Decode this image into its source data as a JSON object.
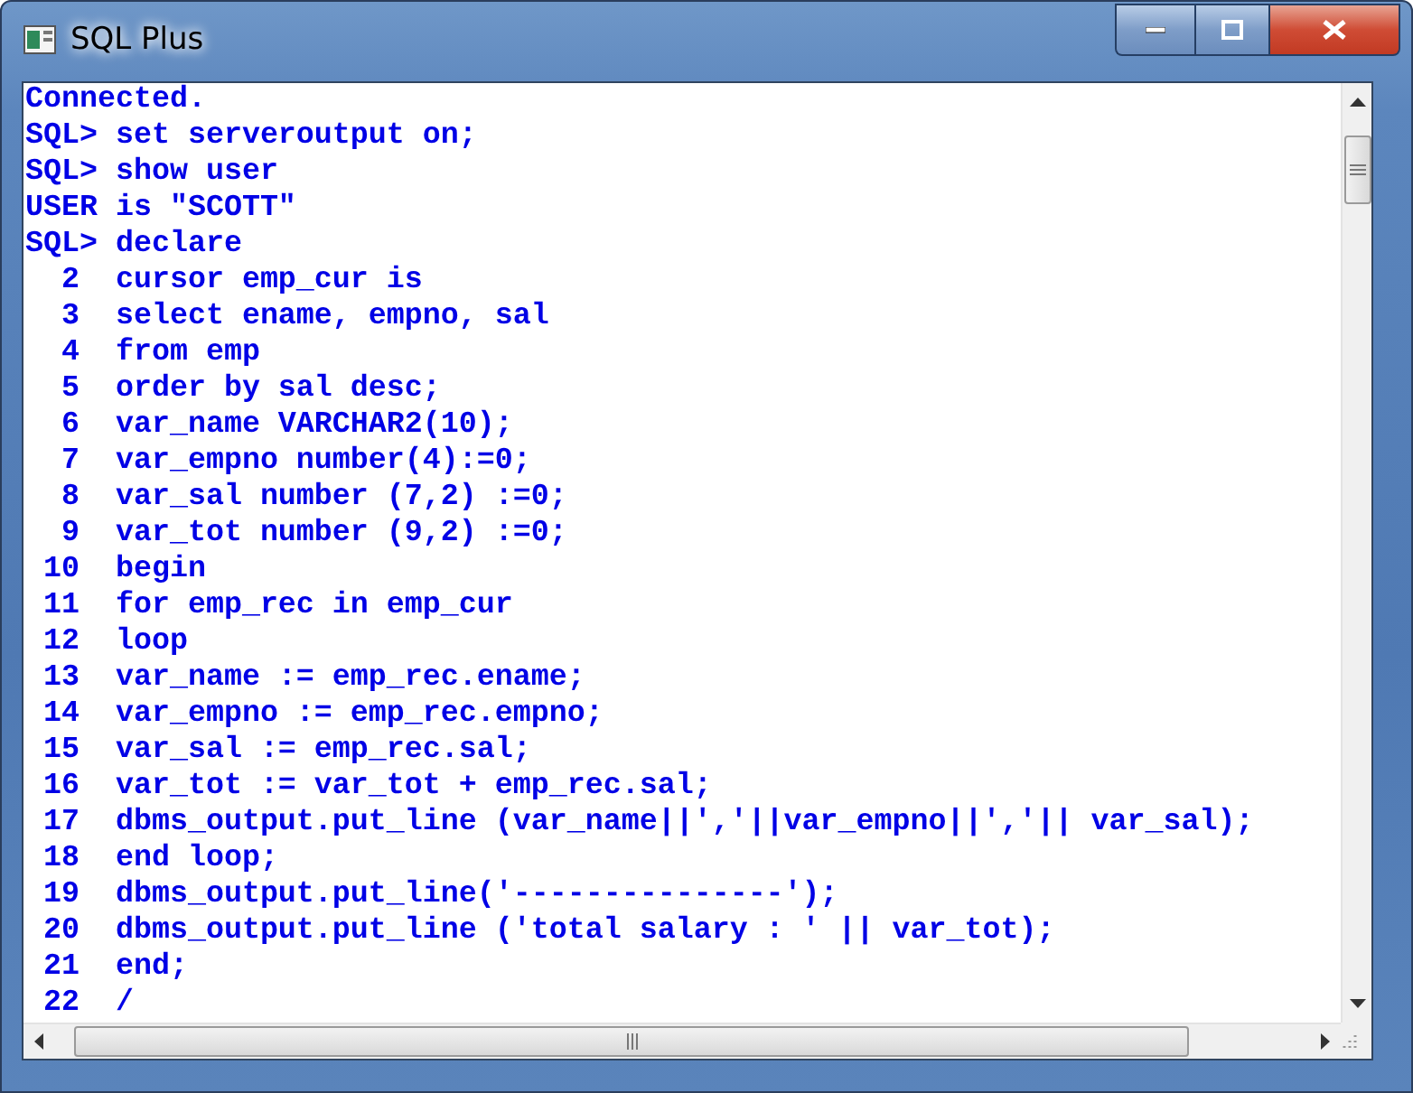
{
  "window": {
    "title": "SQL Plus"
  },
  "console": {
    "lines": [
      "Connected.",
      "SQL> set serveroutput on;",
      "SQL> show user",
      "USER is \"SCOTT\"",
      "SQL> declare",
      "  2  cursor emp_cur is",
      "  3  select ename, empno, sal",
      "  4  from emp",
      "  5  order by sal desc;",
      "  6  var_name VARCHAR2(10);",
      "  7  var_empno number(4):=0;",
      "  8  var_sal number (7,2) :=0;",
      "  9  var_tot number (9,2) :=0;",
      " 10  begin",
      " 11  for emp_rec in emp_cur",
      " 12  loop",
      " 13  var_name := emp_rec.ename;",
      " 14  var_empno := emp_rec.empno;",
      " 15  var_sal := emp_rec.sal;",
      " 16  var_tot := var_tot + emp_rec.sal;",
      " 17  dbms_output.put_line (var_name||','||var_empno||','|| var_sal);",
      " 18  end loop;",
      " 19  dbms_output.put_line('---------------');",
      " 20  dbms_output.put_line ('total salary : ' || var_tot);",
      " 21  end;",
      " 22  /"
    ]
  }
}
